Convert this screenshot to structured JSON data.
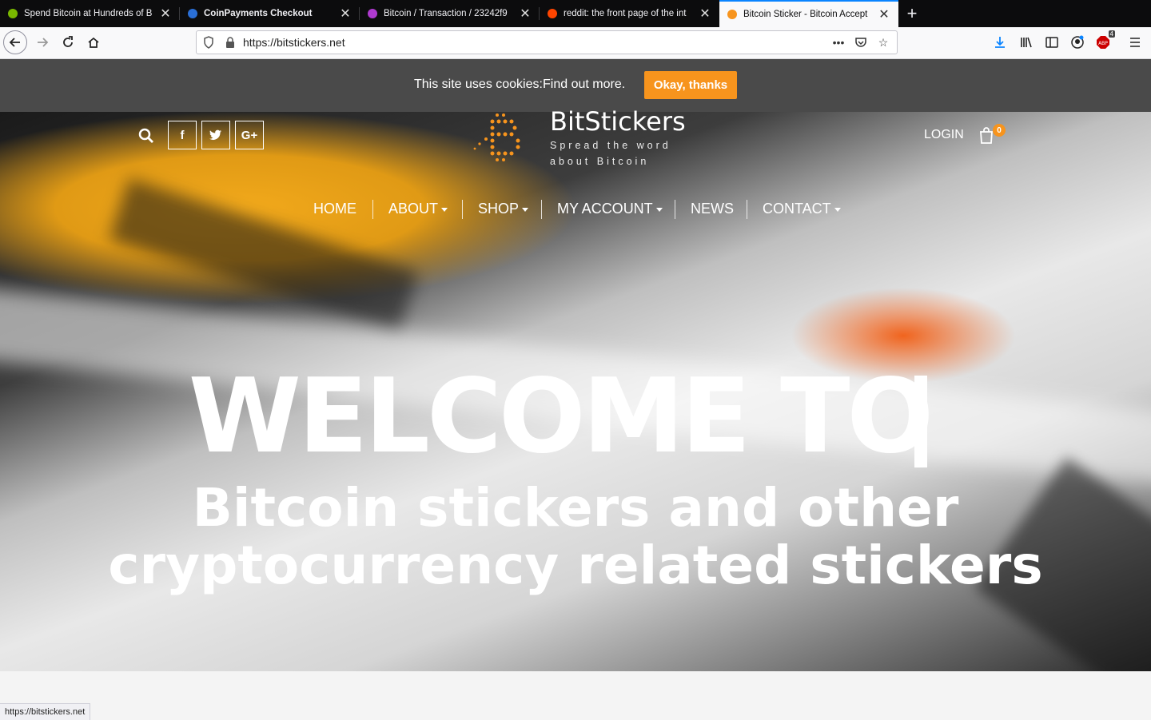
{
  "browser": {
    "tabs": [
      {
        "title": "Spend Bitcoin at Hundreds of B",
        "favicon_color": "#7ab800"
      },
      {
        "title": "CoinPayments Checkout",
        "favicon_color": "#2a6fd6"
      },
      {
        "title": "Bitcoin / Transaction / 23242f9",
        "favicon_color": "#b03ad0"
      },
      {
        "title": "reddit: the front page of the int",
        "favicon_color": "#ff4500"
      },
      {
        "title": "Bitcoin Sticker - Bitcoin Accept",
        "favicon_color": "#f7941d"
      }
    ],
    "url": "https://bitstickers.net",
    "status_url": "https://bitstickers.net",
    "addon_badge": "4"
  },
  "cookie": {
    "text": "This site uses cookies:",
    "link": "Find out more.",
    "button": "Okay, thanks"
  },
  "site": {
    "brand": "BitStickers",
    "tagline": "Spread the word about Bitcoin",
    "login": "LOGIN",
    "cart_count": "0",
    "social": [
      "f",
      "t",
      "G+"
    ],
    "menu": [
      "HOME",
      "ABOUT",
      "SHOP",
      "MY ACCOUNT",
      "NEWS",
      "CONTACT"
    ]
  },
  "hero": {
    "headline": "WELCOME TO",
    "subline_1": "Bitcoin stickers and other",
    "subline_2": "cryptocurrency related stickers"
  },
  "colors": {
    "accent": "#f7941d",
    "cookie_bar": "#4a4a4a",
    "tab_active_border": "#0a84ff"
  }
}
